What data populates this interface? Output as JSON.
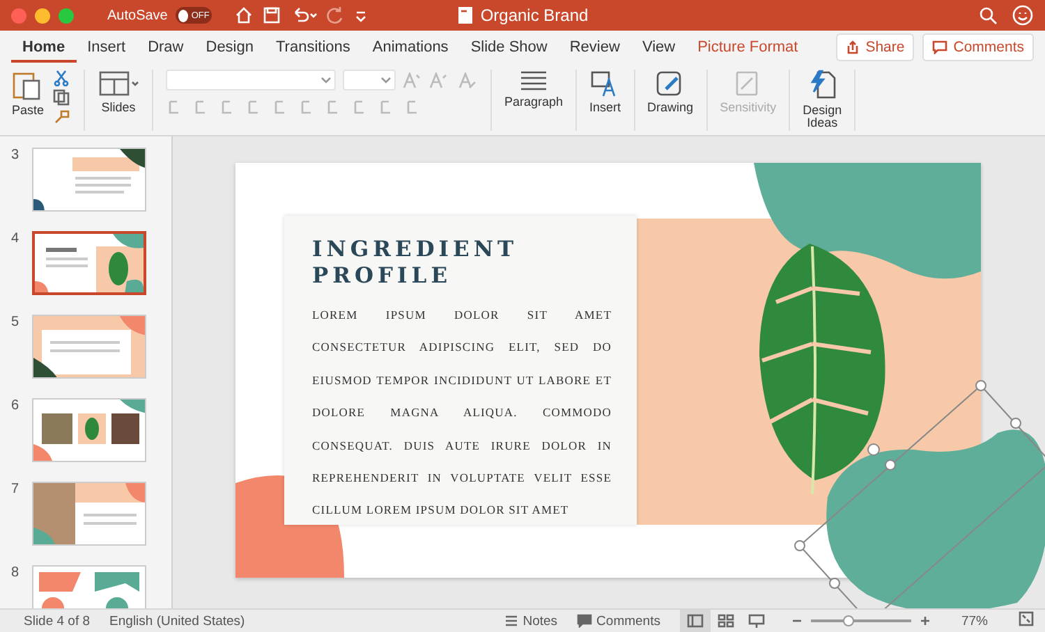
{
  "title_bar": {
    "autosave_label": "AutoSave",
    "autosave": {
      "on": false,
      "label": "OFF"
    },
    "title": "Organic Brand"
  },
  "tabs": [
    {
      "label": "Home",
      "selected": true,
      "kind": "normal"
    },
    {
      "label": "Insert",
      "selected": false,
      "kind": "normal"
    },
    {
      "label": "Draw",
      "selected": false,
      "kind": "normal"
    },
    {
      "label": "Design",
      "selected": false,
      "kind": "normal"
    },
    {
      "label": "Transitions",
      "selected": false,
      "kind": "normal"
    },
    {
      "label": "Animations",
      "selected": false,
      "kind": "normal"
    },
    {
      "label": "Slide Show",
      "selected": false,
      "kind": "normal"
    },
    {
      "label": "Review",
      "selected": false,
      "kind": "normal"
    },
    {
      "label": "View",
      "selected": false,
      "kind": "normal"
    },
    {
      "label": "Picture Format",
      "selected": false,
      "kind": "contextual"
    }
  ],
  "share_button": "Share",
  "comments_button": "Comments",
  "ribbon": {
    "paste": "Paste",
    "slides": "Slides",
    "groups": [
      {
        "label": "Paragraph",
        "kind": "paragraph",
        "disabled": false
      },
      {
        "label": "Insert",
        "kind": "insert",
        "disabled": false
      },
      {
        "label": "Drawing",
        "kind": "drawing",
        "disabled": false
      },
      {
        "label": "Sensitivity",
        "kind": "sensitivity",
        "disabled": true
      },
      {
        "label": "Design\nIdeas",
        "kind": "design",
        "disabled": false
      }
    ]
  },
  "slides": [
    {
      "number": "3",
      "selected": false,
      "kind": "text-left"
    },
    {
      "number": "4",
      "selected": true,
      "kind": "leaf"
    },
    {
      "number": "5",
      "selected": false,
      "kind": "peach"
    },
    {
      "number": "6",
      "selected": false,
      "kind": "photos"
    },
    {
      "number": "7",
      "selected": false,
      "kind": "photo-text"
    },
    {
      "number": "8",
      "selected": false,
      "kind": "shapes"
    }
  ],
  "slide": {
    "title": "INGREDIENT PROFILE",
    "body": "LOREM IPSUM DOLOR SIT AMET CONSECTETUR ADIPISCING ELIT, SED DO EIUSMOD TEMPOR INCIDIDUNT UT LABORE ET DOLORE MAGNA ALIQUA. COMMODO CONSEQUAT. DUIS AUTE IRURE DOLOR IN REPREHENDERIT IN VOLUPTATE VELIT ESSE CILLUM LOREM IPSUM DOLOR SIT AMET"
  },
  "status_bar": {
    "slide_info": "Slide 4 of 8",
    "language": "English (United States)",
    "notes": "Notes",
    "comments": "Comments",
    "zoom": {
      "level": 0.38
    },
    "zoom_label": "77%"
  }
}
